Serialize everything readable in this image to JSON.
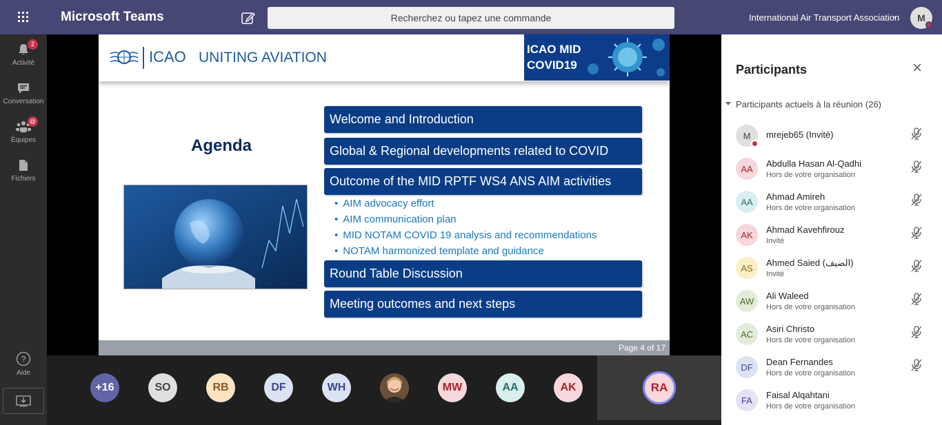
{
  "app": {
    "title": "Microsoft Teams",
    "search_placeholder": "Recherchez ou tapez une commande",
    "org": "International Air Transport Association",
    "me_initial": "M"
  },
  "rail": [
    {
      "label": "Activité",
      "badge": "2"
    },
    {
      "label": "Conversation"
    },
    {
      "label": "Équipes",
      "badge": "@"
    },
    {
      "label": "Fichiers"
    },
    {
      "label": "Aide"
    }
  ],
  "slide": {
    "icao": "ICAO",
    "uniting": "UNITING AVIATION",
    "banner_line1": "ICAO MID",
    "banner_line2": "COVID19",
    "agenda": "Agenda",
    "items": [
      "Welcome and Introduction",
      "Global & Regional developments related to COVID",
      "Outcome of the MID RPTF WS4 ANS AIM activities",
      "Round Table Discussion",
      "Meeting outcomes and next steps"
    ],
    "subitems": [
      "AIM advocacy effort",
      "AIM communication plan",
      "MID NOTAM COVID 19 analysis and recommendations",
      "NOTAM harmonized template and guidance"
    ],
    "page": "Page 4 of 17"
  },
  "roster": [
    {
      "initials": "+16",
      "bg": "#6264a7",
      "fg": "#ffffff"
    },
    {
      "initials": "SO",
      "bg": "#e1dfdd",
      "fg": "#444444"
    },
    {
      "initials": "RB",
      "bg": "#fbe3c4",
      "fg": "#8a5a1f"
    },
    {
      "initials": "DF",
      "bg": "#dbe2f4",
      "fg": "#3a4a8a"
    },
    {
      "initials": "WH",
      "bg": "#dbe2f4",
      "fg": "#3a4a8a"
    },
    {
      "initials": "",
      "bg": "#8b6a4e",
      "fg": "#ffffff"
    },
    {
      "initials": "MW",
      "bg": "#f6d7dc",
      "fg": "#a4262c"
    },
    {
      "initials": "AA",
      "bg": "#d9eeee",
      "fg": "#2c6e6e"
    },
    {
      "initials": "AK",
      "bg": "#f6d7dc",
      "fg": "#a4262c"
    }
  ],
  "active_speaker": "RA",
  "panel": {
    "title": "Participants",
    "section": "Participants actuels à la réunion (26)",
    "participants": [
      {
        "initials": "M",
        "name": "mrejeb65 (Invité)",
        "sub": "",
        "bg": "#e1dfdd",
        "fg": "#444444"
      },
      {
        "initials": "AA",
        "name": "Abdulla Hasan Al-Qadhi",
        "sub": "Hors de votre organisation",
        "bg": "#f6d7dc",
        "fg": "#a4262c"
      },
      {
        "initials": "AA",
        "name": "Ahmad Amireh",
        "sub": "Hors de votre organisation",
        "bg": "#d9eeee",
        "fg": "#2c6e6e"
      },
      {
        "initials": "AK",
        "name": "Ahmad Kavehfirouz",
        "sub": "Invité",
        "bg": "#f6d7dc",
        "fg": "#a4262c"
      },
      {
        "initials": "AS",
        "name": "Ahmed Saied (الضيف)",
        "sub": "Invité",
        "bg": "#fbefc4",
        "fg": "#8a6d1f"
      },
      {
        "initials": "AW",
        "name": "Ali Waleed",
        "sub": "Hors de votre organisation",
        "bg": "#e3ecd9",
        "fg": "#4a6b2f"
      },
      {
        "initials": "AC",
        "name": "Asiri Christo",
        "sub": "Hors de votre organisation",
        "bg": "#e3ecd9",
        "fg": "#4a6b2f"
      },
      {
        "initials": "DF",
        "name": "Dean Fernandes",
        "sub": "Hors de votre organisation",
        "bg": "#dbe2f4",
        "fg": "#3a4a8a"
      },
      {
        "initials": "FA",
        "name": "Faisal Alqahtani",
        "sub": "Hors de votre organisation",
        "bg": "#e4e2f4",
        "fg": "#4a3f8a"
      }
    ]
  }
}
